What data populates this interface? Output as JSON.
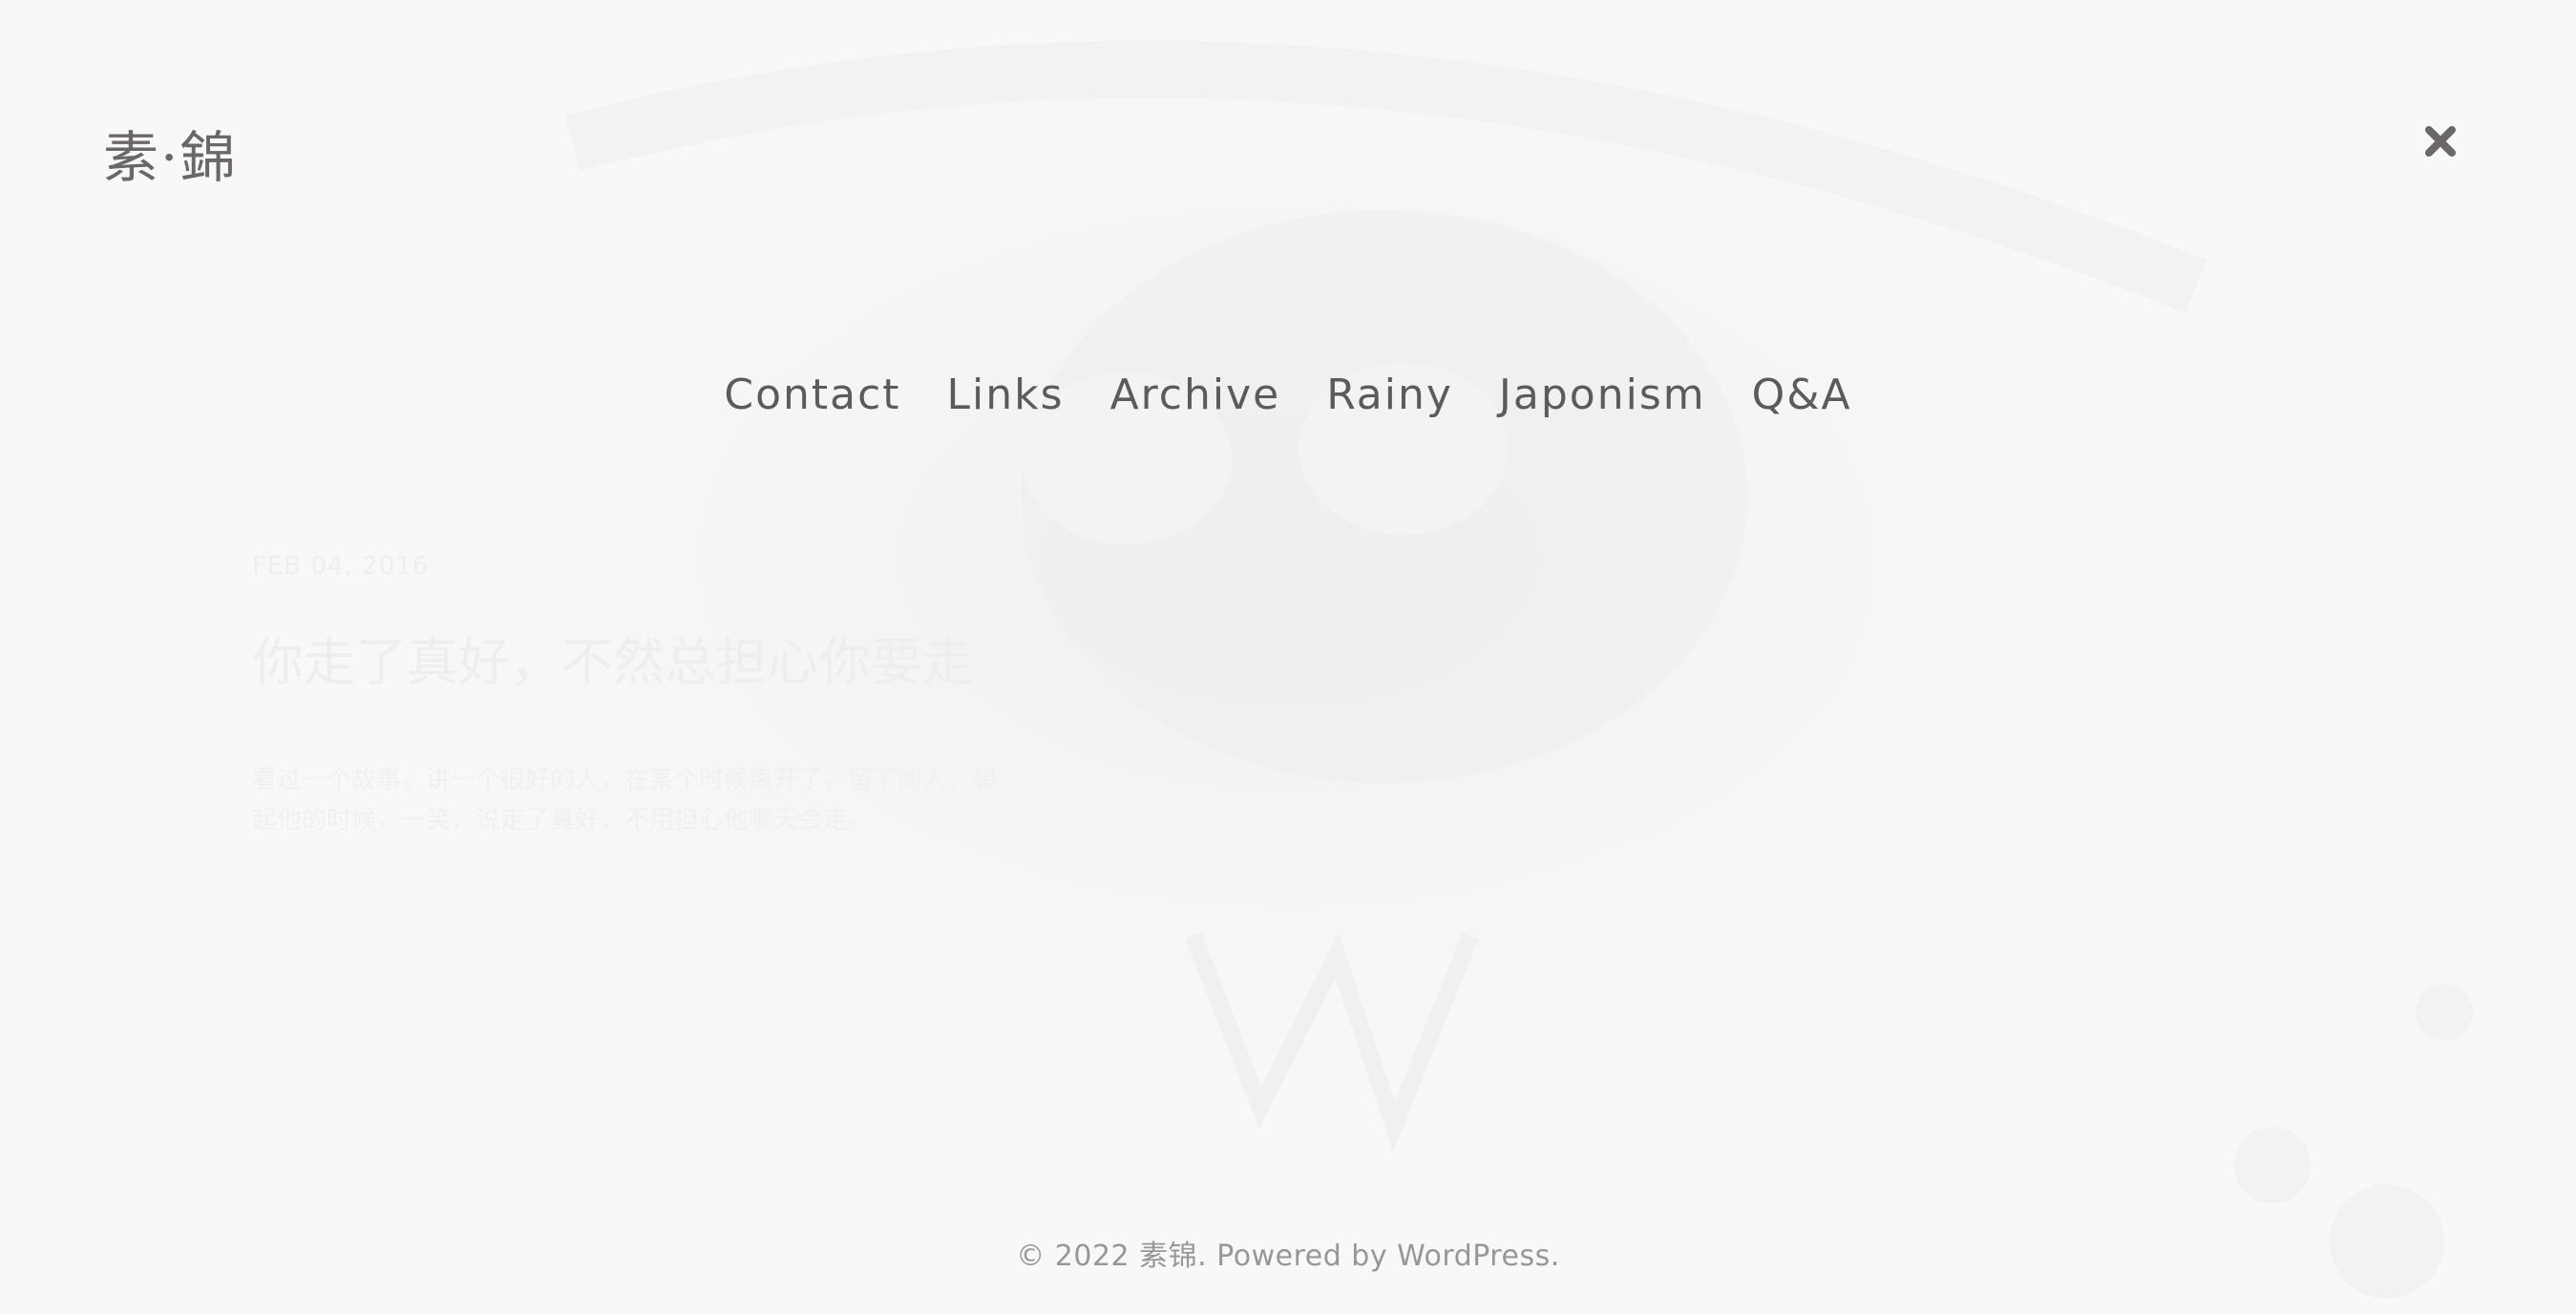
{
  "site": {
    "logo": "素·錦"
  },
  "header": {
    "close_icon": "close-icon"
  },
  "nav": {
    "items": [
      {
        "label": "Contact"
      },
      {
        "label": "Links"
      },
      {
        "label": "Archive"
      },
      {
        "label": "Rainy"
      },
      {
        "label": "Japonism"
      },
      {
        "label": "Q&A"
      }
    ]
  },
  "background_post": {
    "date": "FEB 04, 2016",
    "title": "你走了真好，不然总担心你要走",
    "excerpt": "看过一个故事，讲一个很好的人，在某个时候离开了，留下的人，想起他的时候，一笑，说走了真好，不用担心他哪天会走。"
  },
  "footer": {
    "text": "© 2022 素锦. Powered by WordPress."
  },
  "colors": {
    "background": "#f9f8f8",
    "nav_text": "#5d5a5b",
    "footer_text": "#9a9697",
    "close_icon": "#6b6767"
  }
}
